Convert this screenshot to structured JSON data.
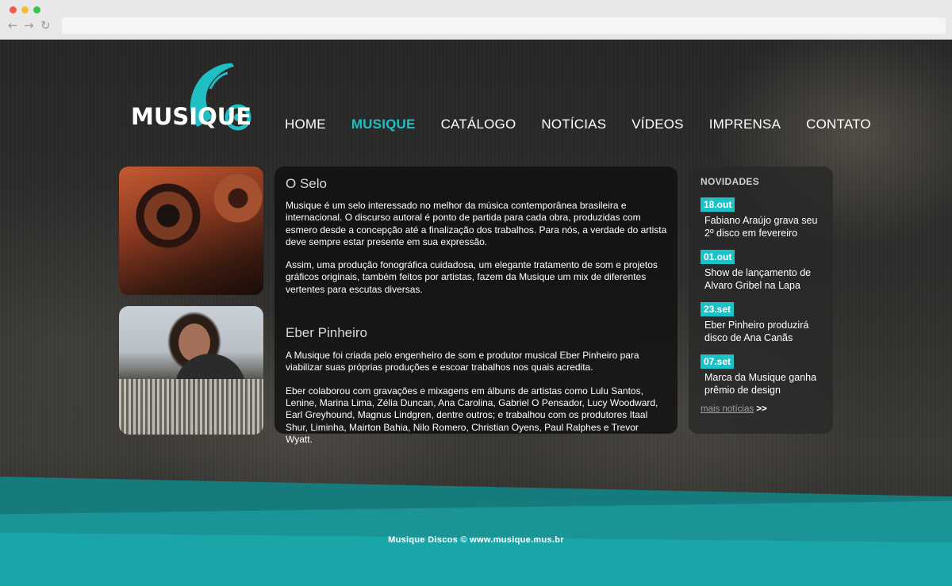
{
  "browser": {
    "back": "←",
    "forward": "→",
    "reload": "↻"
  },
  "logo": {
    "text": "MUSIQUE"
  },
  "nav": {
    "items": [
      {
        "label": "HOME"
      },
      {
        "label": "MUSIQUE",
        "active": true
      },
      {
        "label": "CATÁLOGO"
      },
      {
        "label": "NOTÍCIAS"
      },
      {
        "label": "VÍDEOS"
      },
      {
        "label": "IMPRENSA"
      },
      {
        "label": "CONTATO"
      }
    ]
  },
  "content": {
    "section1_title": "O Selo",
    "section1_p1": "Musique é um selo interessado no melhor da música contemporânea brasileira e internacional. O discurso autoral é ponto de partida para cada obra, produzidas com esmero desde a concepção até a finalização dos trabalhos. Para nós, a verdade do artista deve sempre estar presente em sua expressão.",
    "section1_p2": "Assim, uma produção fonográfica cuidadosa,  um elegante tratamento de som e projetos gráficos originais, também feitos por artistas, fazem da Musique um mix de diferentes vertentes para escutas diversas.",
    "section2_title": "Eber Pinheiro",
    "section2_p1": "A Musique foi criada pelo engenheiro de som e produtor musical Eber Pinheiro para viabilizar suas próprias produções e escoar trabalhos nos quais acredita.",
    "section2_p2": "Eber colaborou com gravações e mixagens em álbuns de artistas como Lulu Santos, Lenine, Marina Lima, Zélia Duncan, Ana Carolina, Gabriel O Pensador, Lucy Woodward, Earl Greyhound, Magnus Lindgren, dentre outros; e trabalhou com os produtores Itaal Shur, Liminha, Mairton Bahia, Nilo Romero, Christian Oyens, Paul Ralphes e Trevor Wyatt."
  },
  "news": {
    "title": "NOVIDADES",
    "items": [
      {
        "date": "18.out",
        "text": "Fabiano Araújo grava seu 2º disco em fevereiro"
      },
      {
        "date": "01.out",
        "text": "Show de lançamento de Alvaro Gribel na Lapa"
      },
      {
        "date": "23.set",
        "text": "Eber Pinheiro produzirá disco de  Ana Canãs"
      },
      {
        "date": "07.set",
        "text": "Marca da Musique ganha prêmio de design"
      }
    ],
    "more_label": "mais notícias",
    "more_arrow": ">>"
  },
  "footer": {
    "text": "Musique Discos © www.musique.mus.br"
  },
  "colors": {
    "accent": "#1fbfc4",
    "date_badge": "#19c3c8",
    "footer_teal": "#1a9496"
  }
}
